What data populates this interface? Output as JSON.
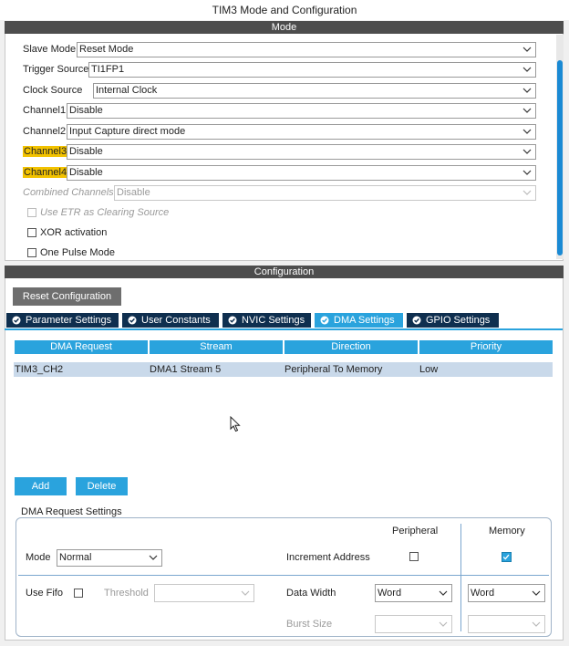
{
  "window": {
    "title": "TIM3 Mode and Configuration"
  },
  "mode": {
    "header": "Mode",
    "rows": [
      {
        "label": "Slave Mode",
        "value": "Reset Mode"
      },
      {
        "label": "Trigger Source",
        "value": "TI1FP1"
      },
      {
        "label": "Clock Source",
        "value": "Internal Clock"
      },
      {
        "label": "Channel1",
        "value": "Disable"
      },
      {
        "label": "Channel2",
        "value": "Input Capture direct mode"
      },
      {
        "label": "Channel3",
        "value": "Disable"
      },
      {
        "label": "Channel4",
        "value": "Disable"
      },
      {
        "label": "Combined Channels",
        "value": "Disable"
      }
    ],
    "checkboxes": {
      "etr": "Use ETR as Clearing Source",
      "xor": "XOR activation",
      "one_pulse": "One Pulse Mode"
    },
    "highlight_color": "#f2c200"
  },
  "configuration": {
    "header": "Configuration",
    "reset_button": "Reset Configuration",
    "tabs": [
      "Parameter Settings",
      "User Constants",
      "NVIC Settings",
      "DMA Settings",
      "GPIO Settings"
    ],
    "active_tab": "DMA Settings",
    "accent_color": "#2aa3dd",
    "table": {
      "headers": [
        "DMA Request",
        "Stream",
        "Direction",
        "Priority"
      ],
      "rows": [
        [
          "TIM3_CH2",
          "DMA1 Stream 5",
          "Peripheral To Memory",
          "Low"
        ]
      ]
    },
    "add_button": "Add",
    "delete_button": "Delete",
    "dma_settings": {
      "title": "DMA Request Settings",
      "peripheral_label": "Peripheral",
      "memory_label": "Memory",
      "mode_label": "Mode",
      "mode_value": "Normal",
      "increment_label": "Increment Address",
      "peripheral_increment": false,
      "memory_increment": true,
      "fifo_label": "Use Fifo",
      "threshold_label": "Threshold",
      "threshold_value": "",
      "data_width_label": "Data Width",
      "peripheral_width": "Word",
      "memory_width": "Word",
      "burst_label": "Burst Size",
      "peripheral_burst": "",
      "memory_burst": ""
    }
  }
}
